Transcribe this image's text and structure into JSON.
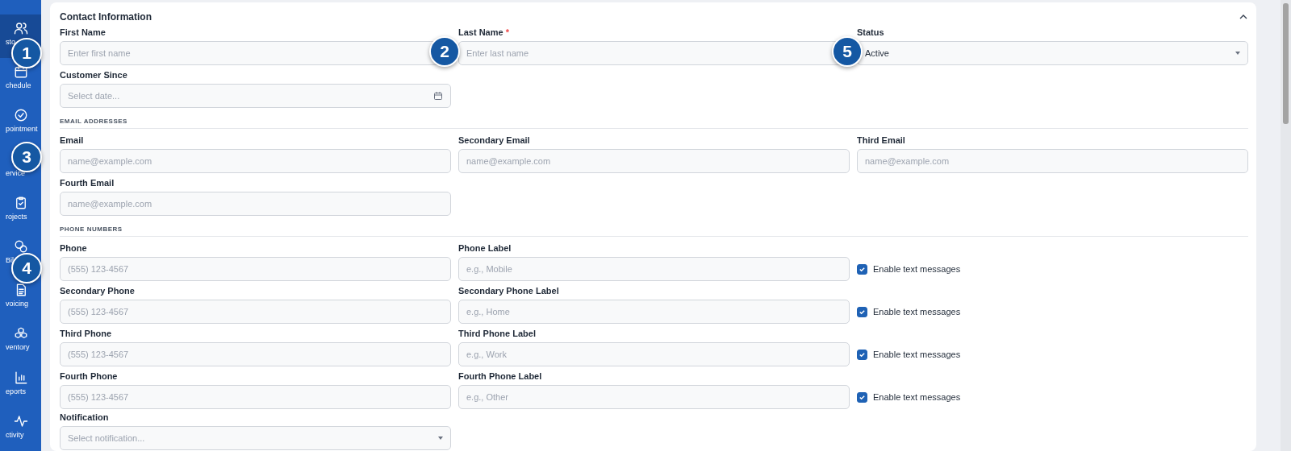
{
  "sidebar": {
    "items": [
      {
        "label": "sto",
        "selected": true
      },
      {
        "label": "chedule",
        "selected": false
      },
      {
        "label": "pointment",
        "selected": false
      },
      {
        "label": "ervice",
        "selected": false
      },
      {
        "label": "rojects",
        "selected": false
      },
      {
        "label": "Bil",
        "selected": false
      },
      {
        "label": "voicing",
        "selected": false
      },
      {
        "label": "ventory",
        "selected": false
      },
      {
        "label": "eports",
        "selected": false
      },
      {
        "label": "ctivity",
        "selected": false
      }
    ]
  },
  "card": {
    "title": "Contact Information",
    "expanded": true,
    "contact_fields": [
      {
        "kind": "text",
        "label": "First Name",
        "placeholder": "Enter first name"
      },
      {
        "kind": "text",
        "label": "Last Name",
        "required_mark": "*",
        "placeholder": "Enter last name"
      },
      {
        "kind": "select",
        "label": "Status",
        "value": "Active"
      },
      {
        "kind": "date",
        "label": "Customer Since",
        "placeholder": "Select date..."
      }
    ],
    "email_section": {
      "heading": "EMAIL ADDRESSES",
      "fields": [
        {
          "kind": "text",
          "label": "Email",
          "placeholder": "name@example.com"
        },
        {
          "kind": "text",
          "label": "Secondary Email",
          "placeholder": "name@example.com"
        },
        {
          "kind": "text",
          "label": "Third Email",
          "placeholder": "name@example.com"
        },
        {
          "kind": "text",
          "label": "Fourth Email",
          "placeholder": "name@example.com"
        }
      ]
    },
    "phone_section": {
      "heading": "PHONE NUMBERS",
      "rows": [
        {
          "phone_label": "Phone",
          "phone_placeholder": "(555) 123-4567",
          "tag_label": "Phone Label",
          "tag_placeholder": "e.g., Mobile",
          "sms_label": "Enable text messages",
          "checked": true
        },
        {
          "phone_label": "Secondary Phone",
          "phone_placeholder": "(555) 123-4567",
          "tag_label": "Secondary Phone Label",
          "tag_placeholder": "e.g., Home",
          "sms_label": "Enable text messages",
          "checked": true
        },
        {
          "phone_label": "Third Phone",
          "phone_placeholder": "(555) 123-4567",
          "tag_label": "Third Phone Label",
          "tag_placeholder": "e.g., Work",
          "sms_label": "Enable text messages",
          "checked": true
        },
        {
          "phone_label": "Fourth Phone",
          "phone_placeholder": "(555) 123-4567",
          "tag_label": "Fourth Phone Label",
          "tag_placeholder": "e.g., Other",
          "sms_label": "Enable text messages",
          "checked": true
        }
      ]
    },
    "notification": {
      "kind": "select",
      "label": "Notification",
      "placeholder": "Select notification..."
    }
  },
  "callouts": [
    "1",
    "2",
    "3",
    "4",
    "5"
  ]
}
